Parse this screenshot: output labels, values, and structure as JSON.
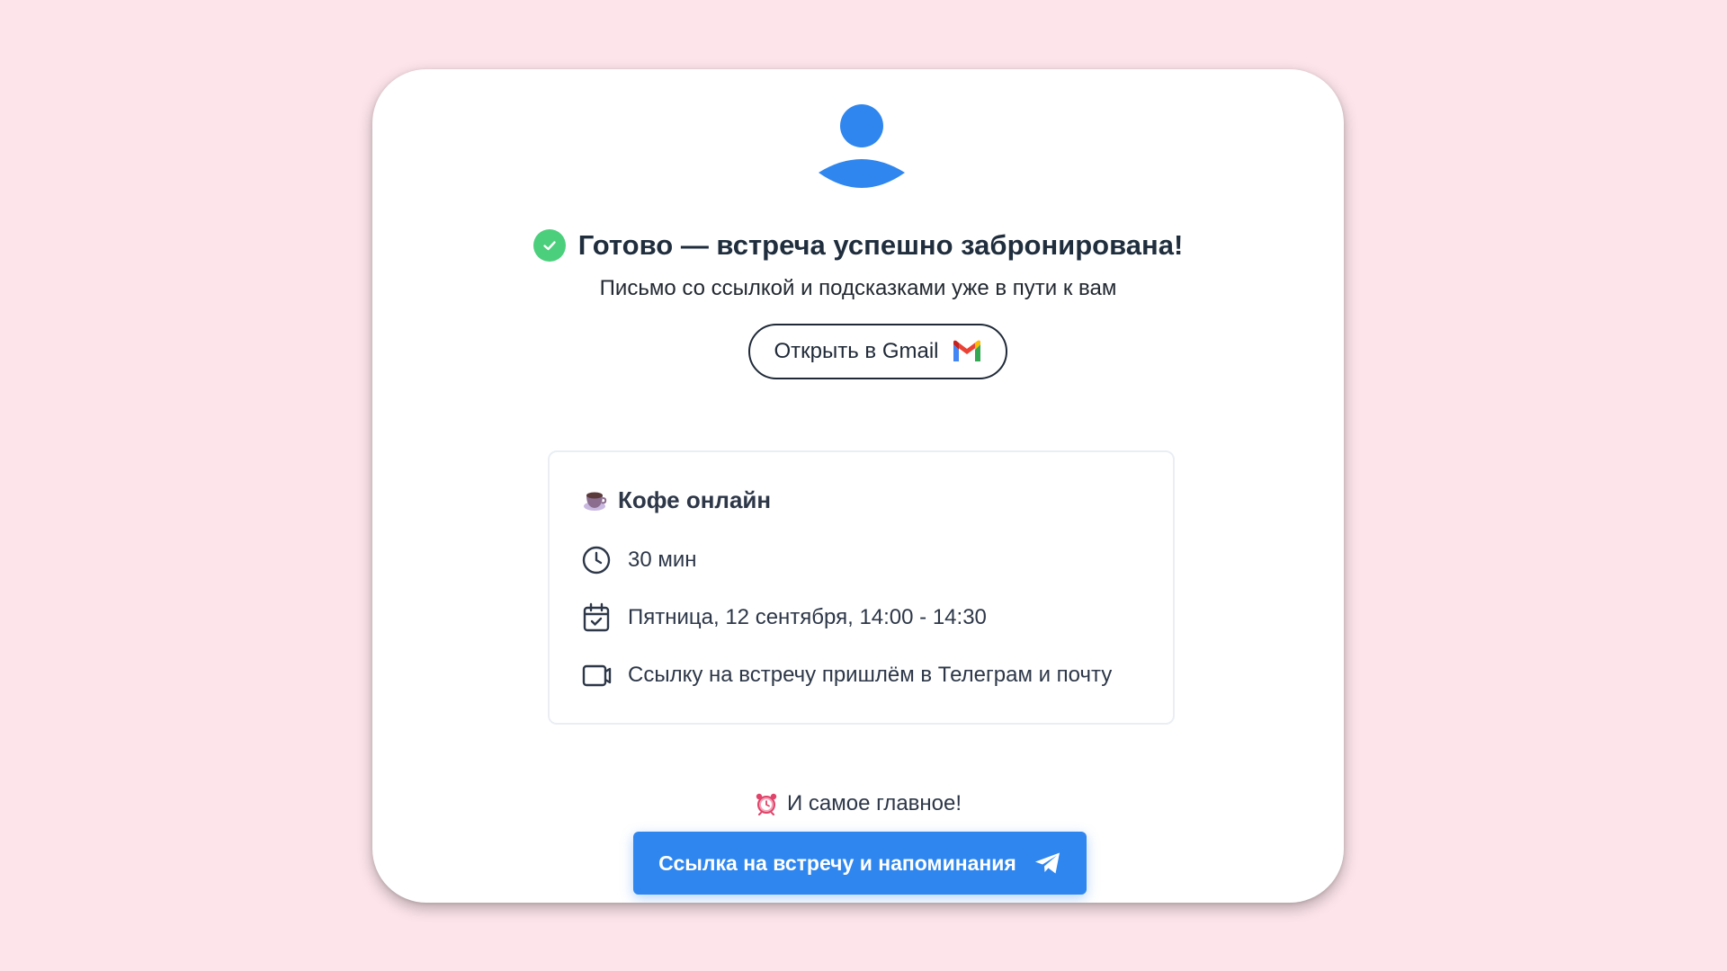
{
  "colors": {
    "page_background": "#fce4ea",
    "card_background": "#ffffff",
    "accent_blue": "#2f86ee",
    "avatar_blue": "#2f86ee",
    "success_green": "#4ccf7c",
    "text_dark": "#1f2d3d"
  },
  "avatar": {
    "icon": "user-avatar-icon"
  },
  "confirmation": {
    "icon": "check-circle-icon",
    "title": "Готово — встреча успешно забронирована!",
    "subtitle": "Письмо со ссылкой и подсказками уже в пути к вам"
  },
  "gmail_button": {
    "label": "Открыть в Gmail",
    "icon": "gmail-icon"
  },
  "event": {
    "icon": "coffee-cup-icon",
    "title": "Кофе онлайн",
    "details": [
      {
        "icon": "clock-icon",
        "text": "30 мин"
      },
      {
        "icon": "calendar-icon",
        "text": "Пятница, 12 сентября, 14:00 - 14:30"
      },
      {
        "icon": "video-icon",
        "text": "Ссылку на встречу пришлём в Телеграм и почту"
      }
    ]
  },
  "main_note": {
    "icon": "alarm-clock-icon",
    "text": "И самое главное!"
  },
  "telegram_button": {
    "label": "Ссылка на встречу и напоминания",
    "icon": "telegram-send-icon"
  }
}
